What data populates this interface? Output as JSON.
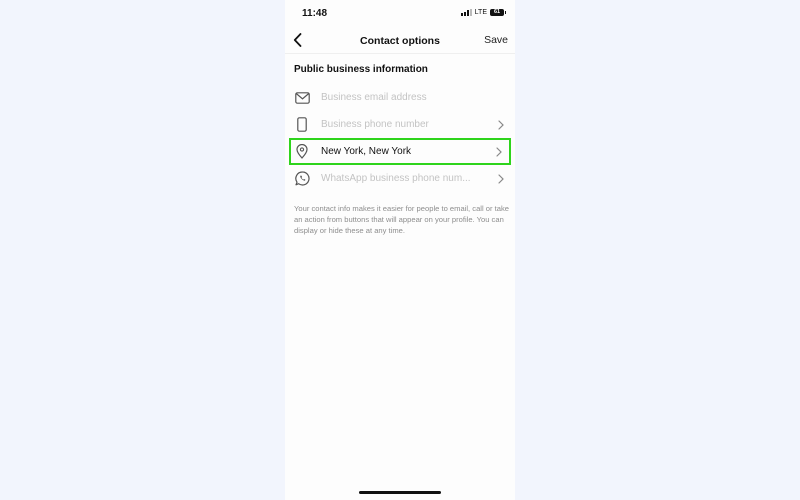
{
  "status_bar": {
    "time": "11:48",
    "network": "LTE",
    "battery": "61"
  },
  "nav": {
    "back_icon": "chevron-left-icon",
    "title": "Contact options",
    "save_label": "Save"
  },
  "section": {
    "title": "Public business information"
  },
  "rows": [
    {
      "icon": "mail-icon",
      "label": "Business email address",
      "filled": false,
      "chevron": false
    },
    {
      "icon": "phone-icon",
      "label": "Business phone number",
      "filled": false,
      "chevron": true
    },
    {
      "icon": "location-pin-icon",
      "label": "New York, New York",
      "filled": true,
      "chevron": true,
      "highlighted": true
    },
    {
      "icon": "whatsapp-icon",
      "label": "WhatsApp business phone num...",
      "filled": false,
      "chevron": true
    }
  ],
  "info_text": "Your contact info makes it easier for people to email, call or take an action from buttons that will appear on your profile. You can display or hide these at any time.",
  "colors": {
    "highlight": "#2ed41c",
    "background": "#f2f5fd"
  }
}
